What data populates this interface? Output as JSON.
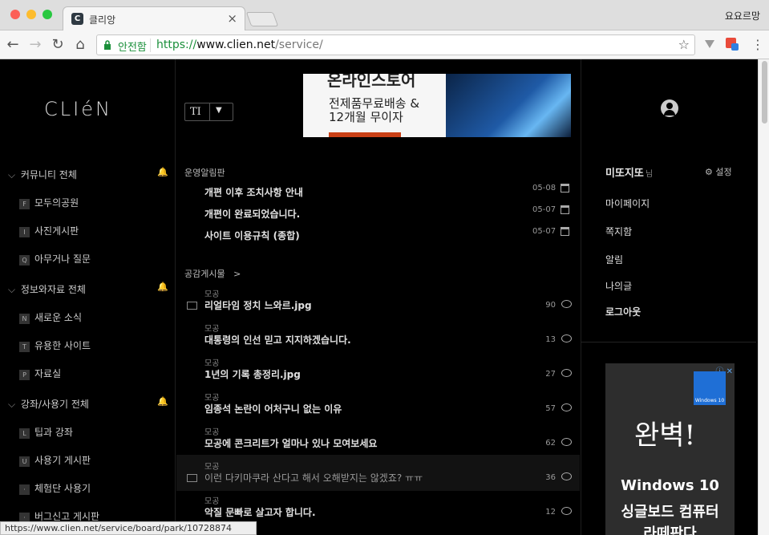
{
  "browser": {
    "tab_title": "클리앙",
    "tab_favicon": "C",
    "profile_name": "요요르망",
    "secure_label": "안전함",
    "url_scheme": "https://",
    "url_host": "www.clien.net",
    "url_path": "/service/",
    "status_url": "https://www.clien.net/service/board/park/10728874"
  },
  "sidebar": {
    "logo": "CLIéN",
    "groups": [
      {
        "label": "커뮤니티 전체",
        "items": [
          {
            "letter": "F",
            "label": "모두의공원"
          },
          {
            "letter": "I",
            "label": "사진게시판"
          },
          {
            "letter": "Q",
            "label": "아무거나 질문"
          }
        ]
      },
      {
        "label": "정보와자료 전체",
        "items": [
          {
            "letter": "N",
            "label": "새로운 소식"
          },
          {
            "letter": "T",
            "label": "유용한 사이트"
          },
          {
            "letter": "P",
            "label": "자료실"
          }
        ]
      },
      {
        "label": "강좌/사용기 전체",
        "items": [
          {
            "letter": "L",
            "label": "팁과 강좌"
          },
          {
            "letter": "U",
            "label": "사용기 게시판"
          },
          {
            "letter": "·",
            "label": "체험단 사용기"
          },
          {
            "letter": "·",
            "label": "버그신고 게시판"
          }
        ]
      }
    ]
  },
  "main": {
    "font_button_label": "TI",
    "banner": {
      "headline": "온라인스토어",
      "line1": "전제품무료배송 &",
      "line2": "12개월 무이자"
    },
    "notice_section": "운영알림판",
    "notices": [
      {
        "title": "개편 이후 조치사항 안내",
        "date": "05-08"
      },
      {
        "title": "개편이 완료되었습니다.",
        "date": "05-07"
      },
      {
        "title": "사이트 이용규칙 (종합)",
        "date": "05-07"
      }
    ],
    "posts_section": "공감게시물",
    "posts_chevron": ">",
    "posts": [
      {
        "category": "모공",
        "title": "리얼타임 정치 느와르.jpg",
        "count": "90",
        "image": true,
        "highlight": false
      },
      {
        "category": "모공",
        "title": "대통령의 인선 믿고 지지하겠습니다.",
        "count": "13",
        "image": false,
        "highlight": false
      },
      {
        "category": "모공",
        "title": "1년의 기록 총정리.jpg",
        "count": "27",
        "image": false,
        "highlight": false
      },
      {
        "category": "모공",
        "title": "임종석 논란이 어처구니 없는 이유",
        "count": "57",
        "image": false,
        "highlight": false
      },
      {
        "category": "모공",
        "title": "모공에 콘크리트가 얼마나 있나 모여보세요",
        "count": "62",
        "image": false,
        "highlight": false
      },
      {
        "category": "모공",
        "title": "이런 다키마쿠라 산다고 해서 오해받지는 않겠죠? ㅠㅠ",
        "count": "36",
        "image": true,
        "highlight": true
      },
      {
        "category": "모공",
        "title": "악질 문빠로 살고자 합니다.",
        "count": "12",
        "image": false,
        "highlight": false
      }
    ]
  },
  "right": {
    "username": "미또지또",
    "username_suffix": "님",
    "settings_label": "설정",
    "links": [
      "마이페이지",
      "쪽지함",
      "알림",
      "나의글",
      "로그아웃"
    ],
    "ad": {
      "icons": "ⓘ ✕",
      "win_badge": "Windows 10",
      "handwriting": "완벽!",
      "t1": "Windows 10",
      "t2": "싱글보드 컴퓨터",
      "t3": "라떼판다"
    }
  }
}
